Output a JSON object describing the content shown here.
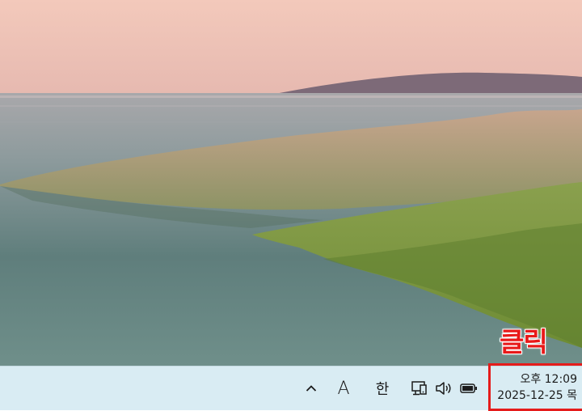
{
  "annotation": {
    "label": "클릭"
  },
  "tray": {
    "ime_mode": "A",
    "ime_language": "한"
  },
  "clock": {
    "time": "오후 12:09",
    "date": "2025-12-25 목"
  },
  "colors": {
    "annotation_red": "#e51b1b",
    "taskbar_bg": "#d9ecf3"
  }
}
